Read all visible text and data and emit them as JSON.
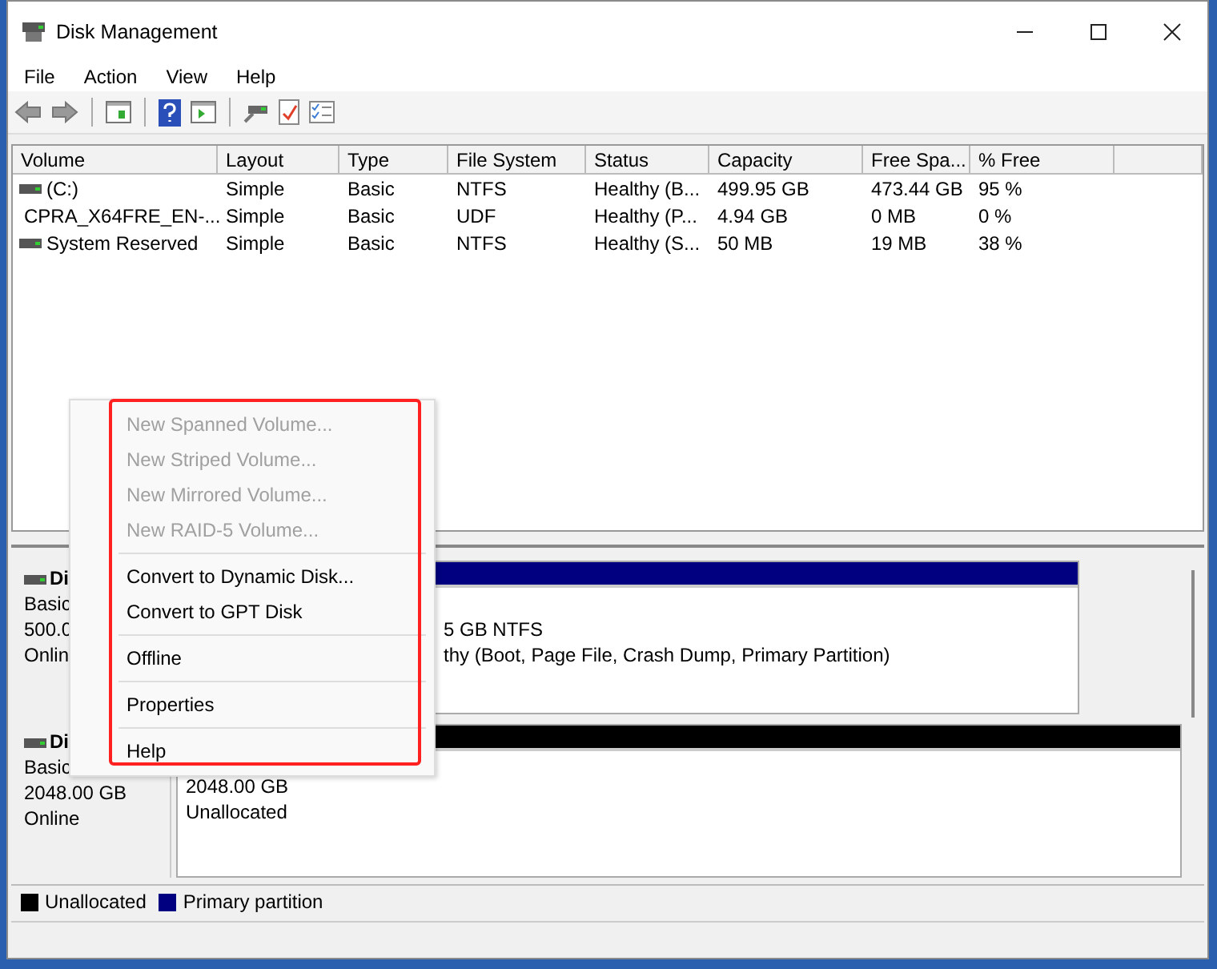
{
  "window": {
    "title": "Disk Management"
  },
  "menu_bar": [
    "File",
    "Action",
    "View",
    "Help"
  ],
  "volume_table": {
    "columns": [
      "Volume",
      "Layout",
      "Type",
      "File System",
      "Status",
      "Capacity",
      "Free Spa...",
      "% Free"
    ],
    "rows": [
      {
        "kind": "hdd",
        "cells": [
          "(C:)",
          "Simple",
          "Basic",
          "NTFS",
          "Healthy (B...",
          "499.95 GB",
          "473.44 GB",
          "95 %"
        ]
      },
      {
        "kind": "cd",
        "cells": [
          "CPRA_X64FRE_EN-...",
          "Simple",
          "Basic",
          "UDF",
          "Healthy (P...",
          "4.94 GB",
          "0 MB",
          "0 %"
        ]
      },
      {
        "kind": "hdd",
        "cells": [
          "System Reserved",
          "Simple",
          "Basic",
          "NTFS",
          "Healthy (S...",
          "50 MB",
          "19 MB",
          "38 %"
        ]
      }
    ]
  },
  "disks": [
    {
      "name": "Di",
      "type": "Basic",
      "size": "500.0",
      "status": "Onlin",
      "partition": {
        "color": "#000080",
        "lines": [
          "5 GB NTFS",
          "thy (Boot, Page File, Crash Dump, Primary Partition)"
        ]
      }
    },
    {
      "name": "Di",
      "type": "Basic",
      "size": "2048.00 GB",
      "status": "Online",
      "partition": {
        "color": "#000000",
        "lines": [
          "2048.00 GB",
          "Unallocated"
        ]
      }
    }
  ],
  "context_menu": {
    "groups": [
      [
        {
          "label": "New Spanned Volume...",
          "disabled": true
        },
        {
          "label": "New Striped Volume...",
          "disabled": true
        },
        {
          "label": "New Mirrored Volume...",
          "disabled": true
        },
        {
          "label": "New RAID-5 Volume...",
          "disabled": true
        }
      ],
      [
        {
          "label": "Convert to Dynamic Disk...",
          "disabled": false
        },
        {
          "label": "Convert to GPT Disk",
          "disabled": false
        }
      ],
      [
        {
          "label": "Offline",
          "disabled": false
        }
      ],
      [
        {
          "label": "Properties",
          "disabled": false
        }
      ],
      [
        {
          "label": "Help",
          "disabled": false
        }
      ]
    ]
  },
  "legend": [
    {
      "label": "Unallocated",
      "color": "#000000"
    },
    {
      "label": "Primary partition",
      "color": "#000080"
    }
  ]
}
